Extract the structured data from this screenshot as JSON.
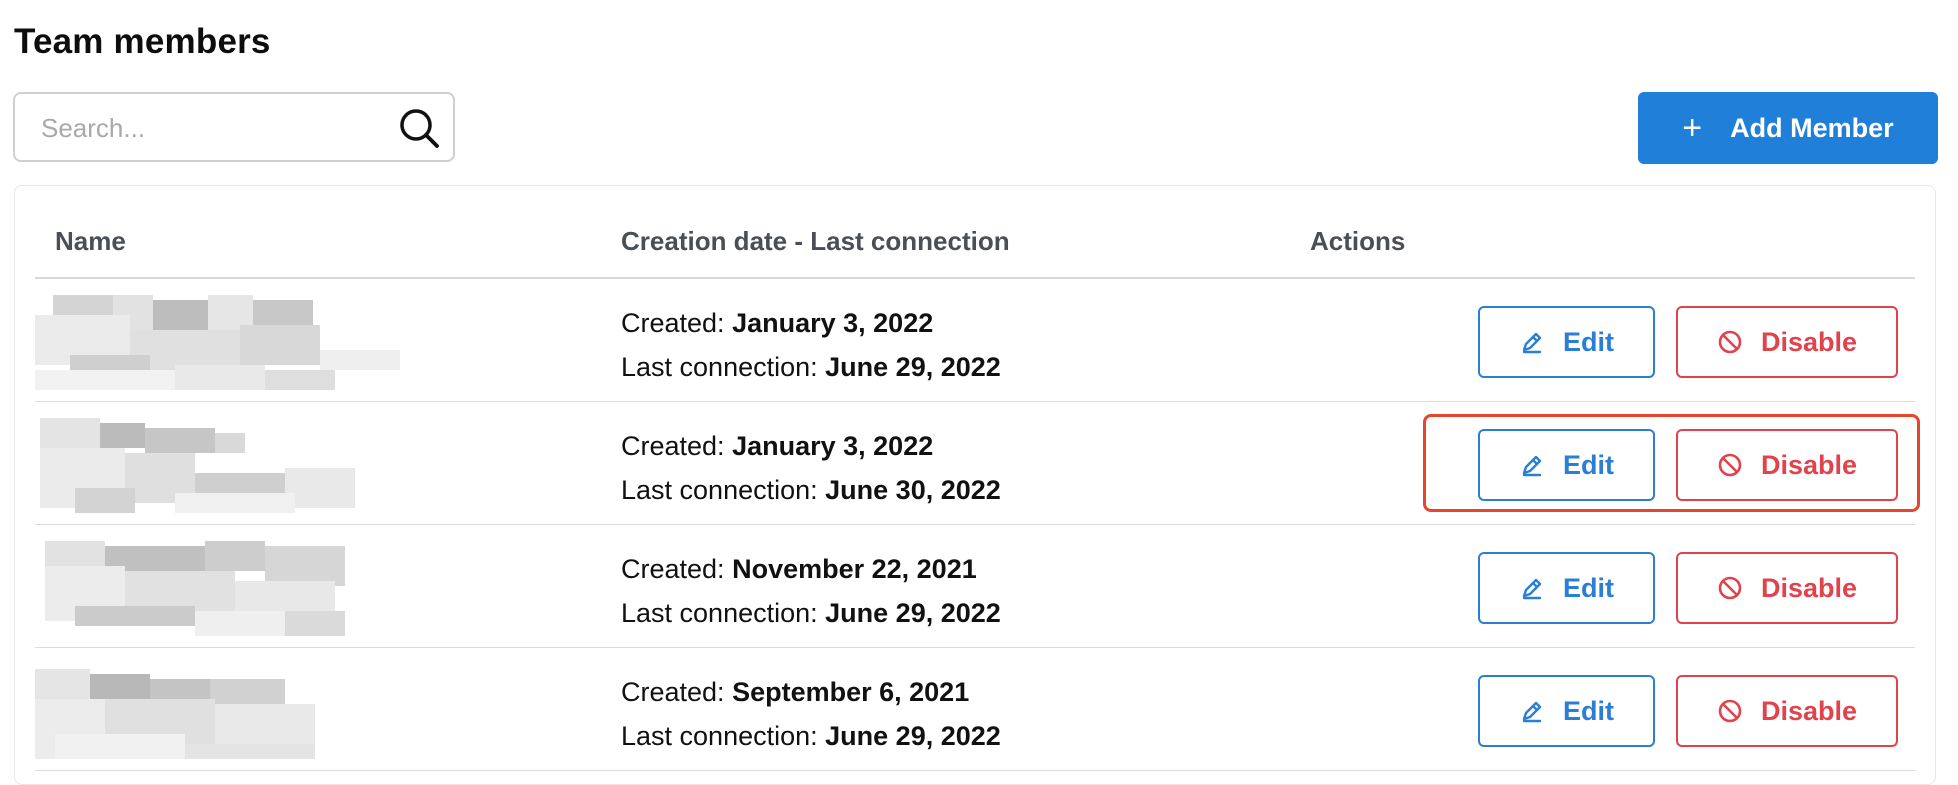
{
  "title": "Team members",
  "search": {
    "placeholder": "Search..."
  },
  "add_button": {
    "plus": "+",
    "label": "Add Member"
  },
  "columns": [
    "Name",
    "Creation date - Last connection",
    "Actions"
  ],
  "labels": {
    "created": "Created:",
    "last_connection": "Last connection:"
  },
  "actions": {
    "edit": "Edit",
    "disable": "Disable"
  },
  "rows": [
    {
      "created": "January 3, 2022",
      "last_connection": "June 29, 2022",
      "highlighted": false
    },
    {
      "created": "January 3, 2022",
      "last_connection": "June 30, 2022",
      "highlighted": true
    },
    {
      "created": "November 22, 2021",
      "last_connection": "June 29, 2022",
      "highlighted": false
    },
    {
      "created": "September 6, 2021",
      "last_connection": "June 29, 2022",
      "highlighted": false
    }
  ],
  "colors": {
    "primary": "#1f7fd9",
    "edit": "#2a7fd4",
    "disable": "#e0434b",
    "highlight": "#e8452e"
  }
}
